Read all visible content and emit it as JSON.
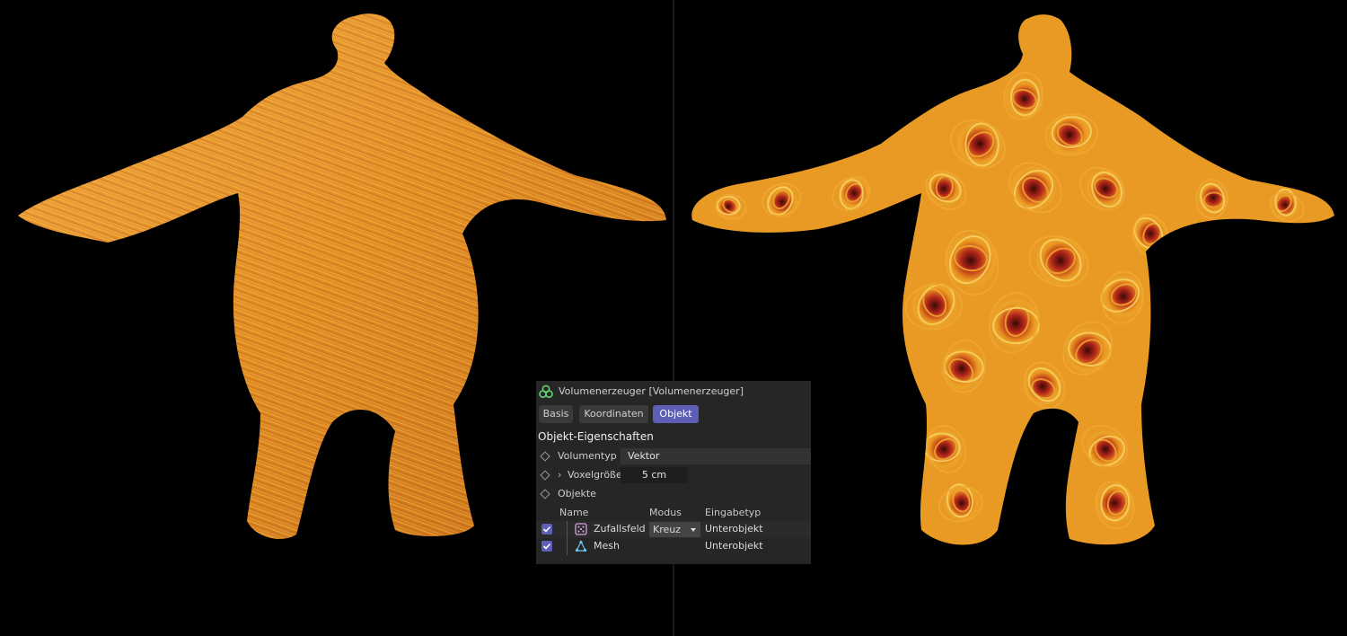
{
  "panel": {
    "title": "Volumenerzeuger [Volumenerzeuger]",
    "tabs": [
      {
        "label": "Basis",
        "active": false
      },
      {
        "label": "Koordinaten",
        "active": false
      },
      {
        "label": "Objekt",
        "active": true
      }
    ],
    "section_title": "Objekt-Eigenschaften",
    "fields": {
      "volume_type": {
        "label": "Volumentyp",
        "value": "Vektor"
      },
      "voxel_size": {
        "label": "Voxelgröße",
        "value": "5 cm"
      },
      "objects": {
        "label": "Objekte"
      }
    },
    "table": {
      "headers": {
        "name": "Name",
        "mode": "Modus",
        "input_type": "Eingabetyp"
      },
      "rows": [
        {
          "checked": true,
          "icon": "random-field-icon",
          "name": "Zufallsfeld",
          "mode": "Kreuz",
          "input_type": "Unterobjekt"
        },
        {
          "checked": true,
          "icon": "mesh-icon",
          "name": "Mesh",
          "mode": "",
          "input_type": "Unterobjekt"
        }
      ]
    }
  },
  "colors": {
    "accent": "#5c5fb5",
    "panel_bg": "#262626",
    "viewport_bg": "#000000",
    "fiber_orange": "#e8941a",
    "fiber_yellow": "#f5c435",
    "fiber_red": "#c2301a"
  }
}
